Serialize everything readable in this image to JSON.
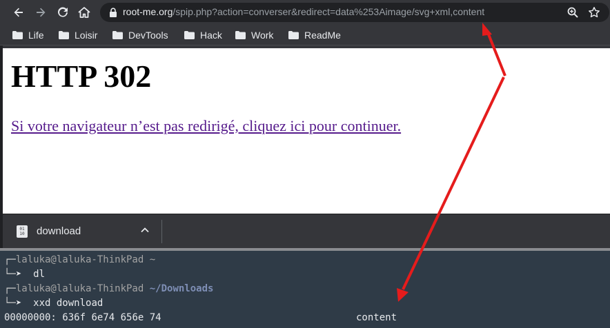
{
  "browser": {
    "url_host": "root-me.org",
    "url_path": "/spip.php?action=converser&redirect=data%253Aimage/svg+xml,content",
    "bookmarks": [
      "Life",
      "Loisir",
      "DevTools",
      "Hack",
      "Work",
      "ReadMe"
    ]
  },
  "page": {
    "title": "HTTP 302",
    "link_text": "Si votre navigateur n’est pas redirigé, cliquez ici pour continuer."
  },
  "download_shelf": {
    "file_name": "download",
    "file_icon_text": "01\n10"
  },
  "terminal": {
    "prompt1_user": "laluka@laluka-ThinkPad",
    "prompt1_path": "~",
    "cmd1": "dl",
    "prompt2_user": "laluka@laluka-ThinkPad",
    "prompt2_path": "~/Downloads",
    "cmd2": "xxd download",
    "output_offset": "00000000:",
    "output_hex": "636f 6e74 656e 74",
    "output_ascii": "content"
  },
  "colors": {
    "annotation_arrow": "#e51c1c",
    "link": "#551a8b",
    "terminal_bg": "#2f3b47"
  }
}
